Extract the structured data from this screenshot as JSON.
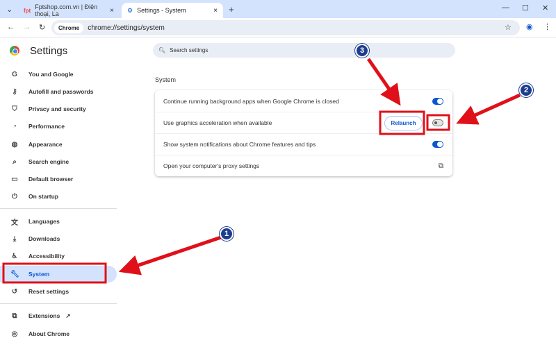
{
  "tabs": [
    {
      "label": "Fptshop.com.vn | Điện thoại, La",
      "close": "×"
    },
    {
      "label": "Settings - System",
      "close": "×"
    }
  ],
  "address": {
    "chip": "Chrome",
    "url": "chrome://settings/system"
  },
  "settings_title": "Settings",
  "search_placeholder": "Search settings",
  "nav": [
    "You and Google",
    "Autofill and passwords",
    "Privacy and security",
    "Performance",
    "Appearance",
    "Search engine",
    "Default browser",
    "On startup",
    "Languages",
    "Downloads",
    "Accessibility",
    "System",
    "Reset settings",
    "Extensions",
    "About Chrome"
  ],
  "section": "System",
  "rows": [
    {
      "label": "Continue running background apps when Google Chrome is closed",
      "toggle": true
    },
    {
      "label": "Use graphics acceleration when available",
      "toggle": false,
      "button": "Relaunch"
    },
    {
      "label": "Show system notifications about Chrome features and tips",
      "toggle": true
    },
    {
      "label": "Open your computer's proxy settings"
    }
  ],
  "annotations": [
    "1",
    "2",
    "3"
  ],
  "colors": {
    "accent": "#0b57d0",
    "annotation": "#e0101a"
  }
}
